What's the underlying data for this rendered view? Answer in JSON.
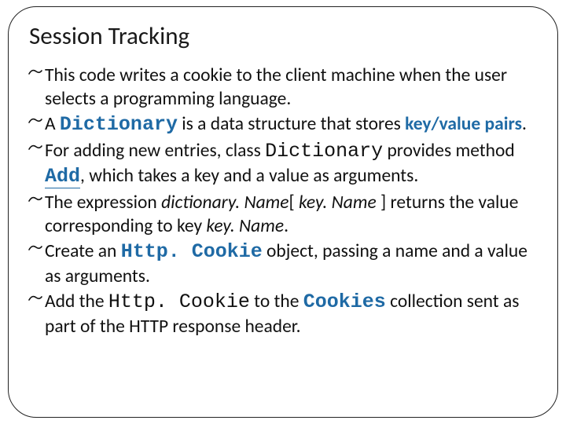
{
  "title": "Session Tracking",
  "bullets": {
    "b1": {
      "t1": "This code writes a cookie to the client machine when the user selects a programming language."
    },
    "b2": {
      "t1": "A ",
      "code": "Dictionary",
      "t2": " is a data structure that stores ",
      "kw": "key/value pairs",
      "t3": "."
    },
    "b3": {
      "t1": "For adding new entries, class ",
      "code": "Dictionary",
      "t2": " provides method ",
      "add": "Add",
      "t3": ", which takes a key and a value as arguments."
    },
    "b4": {
      "t1": "The expression ",
      "i1": "dictionary. Name",
      "t2": "[ ",
      "i2": "key. Name",
      "t3": " ] returns the value corresponding to key ",
      "i3": "key. Name",
      "t4": "."
    },
    "b5": {
      "t1": "Create an ",
      "http1": "Http. ",
      "http2": "Cookie",
      "t2": " object, passing a name and a value as arguments."
    },
    "b6": {
      "t1": "Add the ",
      "http1": "Http. ",
      "http2": "Cookie",
      "t2": " to the ",
      "cookies": "Cookies",
      "t3": " collection sent as part of the HTTP response header."
    }
  }
}
